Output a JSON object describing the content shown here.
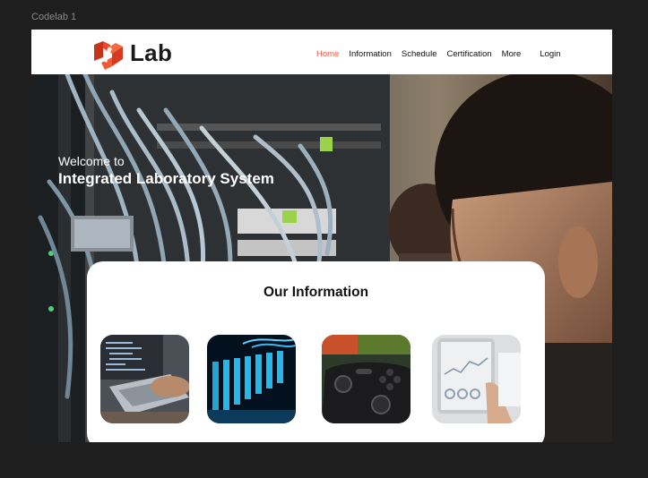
{
  "canvas": {
    "frame_label": "Codelab 1"
  },
  "header": {
    "logo_text": "Lab",
    "nav": [
      {
        "label": "Home",
        "active": true
      },
      {
        "label": "Information",
        "active": false
      },
      {
        "label": "Schedule",
        "active": false
      },
      {
        "label": "Certification",
        "active": false
      },
      {
        "label": "More",
        "active": false
      },
      {
        "label": "Login",
        "active": false
      }
    ]
  },
  "hero": {
    "subtitle": "Welcome to",
    "title": "Integrated Laboratory System"
  },
  "info": {
    "title": "Our Information",
    "cards": [
      {
        "icon": "laptop-code-photo"
      },
      {
        "icon": "server-rack-photo"
      },
      {
        "icon": "game-controller-photo"
      },
      {
        "icon": "tablet-chart-photo"
      }
    ]
  },
  "colors": {
    "accent": "#e35d47",
    "logo_red": "#e8492e",
    "canvas_bg": "#1e1e1e"
  }
}
